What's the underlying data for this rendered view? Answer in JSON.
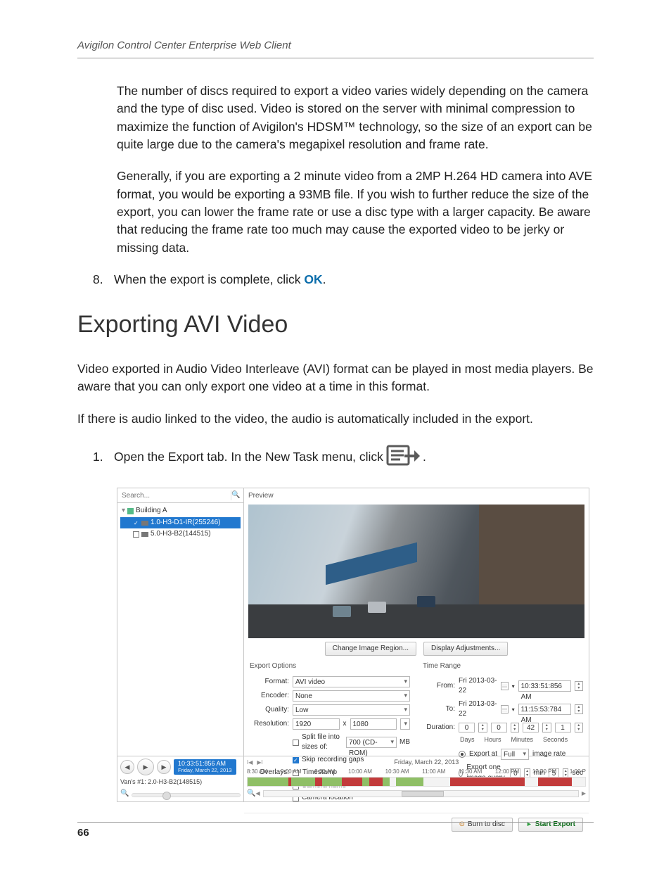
{
  "doc": {
    "running_header": "Avigilon Control Center Enterprise Web Client",
    "page_number": "66",
    "para1": "The number of discs required to export a video varies widely depending on the camera and the type of disc used. Video is stored on the server with minimal compression to maximize the function of Avigilon's HDSM™ technology, so the size of an export can be quite large due to the camera's megapixel resolution and frame rate.",
    "para2": "Generally, if you are exporting a 2 minute video from a 2MP H.264 HD camera into AVE format, you would be exporting a 93MB file. If you wish to further reduce the size of the export, you can lower the frame rate or use a disc type with a larger capacity. Be aware that reducing the frame rate too much may cause the exported video to be jerky or missing data.",
    "step8_num": "8.",
    "step8_a": "When the export is complete, click ",
    "step8_ok": "OK",
    "step8_b": ".",
    "heading": "Exporting AVI Video",
    "para3": "Video exported in Audio Video Interleave (AVI) format can be played in most media players. Be aware that you can only export one video at a time in this format.",
    "para4": "If there is audio linked to the video, the audio is automatically included in the export.",
    "step1_num": "1.",
    "step1_a": "Open the Export tab. In the New Task menu, click ",
    "step1_b": "."
  },
  "ss": {
    "search_placeholder": "Search...",
    "tree": {
      "root": "Building A",
      "cam1": "1.0-H3-D1-IR(255246)",
      "cam2": "5.0-H3-B2(144515)"
    },
    "preview_label": "Preview",
    "btn_change_region": "Change Image Region...",
    "btn_display_adj": "Display Adjustments...",
    "export_options": {
      "title": "Export Options",
      "labels": {
        "format": "Format:",
        "encoder": "Encoder:",
        "quality": "Quality:",
        "resolution": "Resolution:",
        "overlays": "Overlays:"
      },
      "format_value": "AVI video",
      "encoder_value": "None",
      "quality_value": "Low",
      "res_w": "1920",
      "res_x": "x",
      "res_h": "1080",
      "split_label": "Split file into sizes of:",
      "split_value": "700 (CD-ROM)",
      "split_unit": "MB",
      "skip_gaps": "Skip recording gaps",
      "ov_timestamp": "Timestamp",
      "ov_camera_name": "Camera name",
      "ov_camera_location": "Camera location"
    },
    "time_range": {
      "title": "Time Range",
      "from_label": "From:",
      "to_label": "To:",
      "duration_label": "Duration:",
      "from_date": "Fri 2013-03-22",
      "from_time": "10:33:51:856 AM",
      "to_date": "Fri 2013-03-22",
      "to_time": "11:15:53:784 AM",
      "dur_days": "0",
      "dur_hours": "0",
      "dur_min": "42",
      "dur_sec": "1",
      "lab_days": "Days",
      "lab_hours": "Hours",
      "lab_min": "Minutes",
      "lab_sec": "Seconds",
      "export_at_a": "Export at",
      "export_at_val": "Full",
      "export_at_b": "image rate",
      "export_every_a": "Export one image every",
      "export_every_val1": "0",
      "export_every_unit1": "min",
      "export_every_val2": "5",
      "export_every_unit2": "sec"
    },
    "btn_burn": "Burn to disc",
    "btn_start": "Start Export",
    "timeline": {
      "clock": "10:33:51:856 AM",
      "clock_sub": "Friday, March 22, 2013",
      "vans": "Van's #1: 2.0-H3-B2(148515)",
      "date_center": "Friday, March 22, 2013",
      "ticks": [
        "8:30 AM",
        "9:00 AM",
        "9:30 AM",
        "10:00 AM",
        "10:30 AM",
        "11:00 AM",
        "11:30 AM",
        "12:00 PM",
        "12:30 PM",
        "1:00 P"
      ]
    }
  }
}
